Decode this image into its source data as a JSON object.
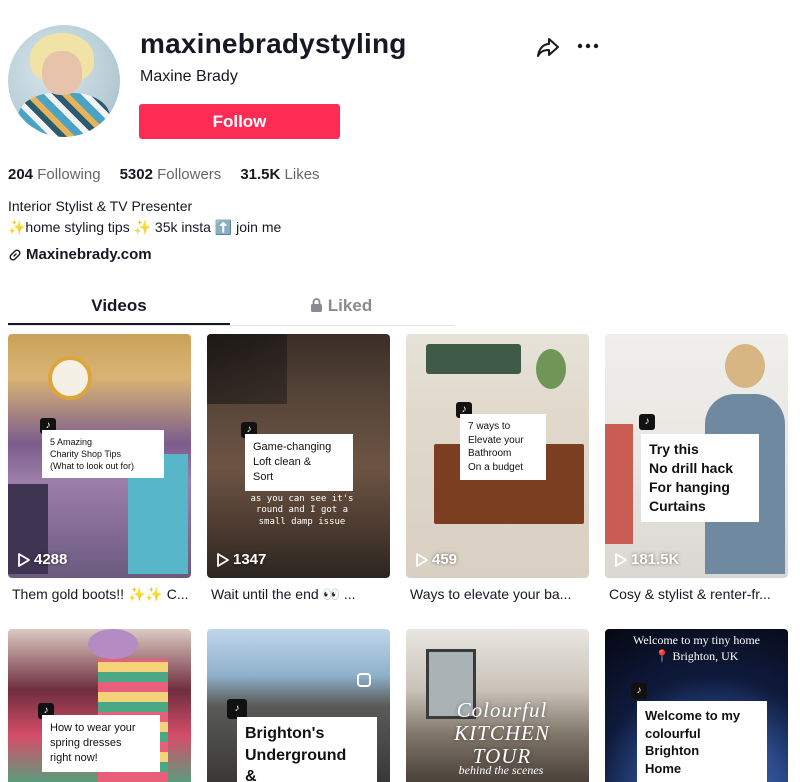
{
  "profile": {
    "username": "maxinebradystyling",
    "fullname": "Maxine Brady",
    "follow_label": "Follow"
  },
  "stats": [
    {
      "value": "204",
      "label": "Following"
    },
    {
      "value": "5302",
      "label": "Followers"
    },
    {
      "value": "31.5K",
      "label": "Likes"
    }
  ],
  "bio": {
    "line1": "Interior Stylist & TV Presenter",
    "line2": "✨home styling tips ✨ 35k insta ⬆️ join me",
    "link": "Maxinebrady.com"
  },
  "tabs": {
    "videos": "Videos",
    "liked": "Liked"
  },
  "colors": {
    "accent": "#fe2c55"
  },
  "videos": [
    {
      "plays": "4288",
      "caption": "5 Amazing\nCharity Shop Tips\n(What to look out for)",
      "desc": "Them gold boots!! ✨✨ C..."
    },
    {
      "plays": "1347",
      "caption": "Game-changing\nLoft clean &\nSort",
      "subtitle": "as you can see it's\nround and I got a\nsmall damp issue",
      "desc": "Wait until the end 👀 ..."
    },
    {
      "plays": "459",
      "caption": "7 ways to\nElevate your\nBathroom\nOn a budget",
      "desc": "Ways to elevate your ba..."
    },
    {
      "plays": "181.5K",
      "caption": "Try this\nNo drill hack\nFor hanging\nCurtains",
      "desc": "Cosy & stylist & renter-fr..."
    },
    {
      "caption": "How to wear your\nspring dresses\nright now!"
    },
    {
      "caption": "Brighton's\nUnderground\n&"
    },
    {
      "caption": "Colourful\nKITCHEN TOUR",
      "subtitle": "behind the scenes"
    },
    {
      "caption": "Welcome to my\ncolourful\nBrighton\nHome",
      "header1": "Welcome to my tiny home",
      "header2": "📍 Brighton, UK"
    }
  ]
}
